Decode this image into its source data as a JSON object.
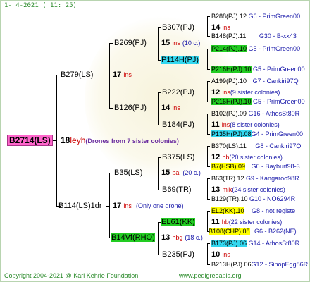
{
  "header": {
    "date_line": "1-  4-2021 ( 11: 25)"
  },
  "root": {
    "name": "B2714(LS)",
    "number": "18",
    "suffix": "leyh",
    "note": "(Drones from 7 sister colonies)"
  },
  "p1": {
    "name": "B279(LS)",
    "number": "17",
    "suffix": "ins"
  },
  "p2": {
    "name": "B114(LS)1dr",
    "number": "17",
    "suffix": "ins",
    "note": "(Only one drone)"
  },
  "g1": {
    "name": "B269(PJ)",
    "number": "15",
    "suffix": "ins",
    "note": "(10 c.)"
  },
  "g2": {
    "name": "B126(PJ)",
    "number": "14",
    "suffix": "ins"
  },
  "g3": {
    "name": "B35(LS)",
    "number": "15",
    "suffix": "bal",
    "note": "(20 c.)"
  },
  "g4": {
    "name": "B14Vf(RHO)",
    "number": "13",
    "suffix": "hbg",
    "note": "(18 c.)"
  },
  "gg": [
    {
      "name": "B307(PJ)",
      "number": "14",
      "suffix": "ins"
    },
    {
      "name": "P114H(PJ)"
    },
    {
      "name": "B222(PJ)",
      "number": "12",
      "suffix": "ins",
      "note": "(9 sister colonies)"
    },
    {
      "name": "B184(PJ)",
      "number": "11",
      "suffix": "ins",
      "note": "(8 sister colonies)"
    },
    {
      "name": "B375(LS)",
      "number": "12",
      "suffix": "hb",
      "note": "(20 sister colonies)"
    },
    {
      "name": "B69(TR)",
      "number": "13",
      "suffix": "mlk",
      "note": "(24 sister colonies)"
    },
    {
      "name": "EL61(KK)",
      "number": "11",
      "suffix": "hb",
      "note": "(22 sister colonies)"
    },
    {
      "name": "B235(PJ)",
      "number": "10",
      "suffix": "ins"
    }
  ],
  "right": [
    {
      "name": "B288(PJ).12",
      "info": "G6 - PrimGreen00"
    },
    {
      "name": "B148(PJ).11",
      "info": "G30 - B-xx43"
    },
    {
      "name": "P214(PJ).10",
      "info": "G5 - PrimGreen00"
    },
    {
      "name": "P216H(PJ).10",
      "info": "G5 - PrimGreen00"
    },
    {
      "name": "A199(PJ).10",
      "info": "G7 - Cankiri97Q"
    },
    {
      "name": "P216H(PJ).10",
      "info": "G5 - PrimGreen00"
    },
    {
      "name": "B102(PJ).09",
      "info": "G16 - AthosSt80R"
    },
    {
      "name": "P135H(PJ).08",
      "info": "G4 - PrimGreen00"
    },
    {
      "name": "B370(LS).11",
      "info": "G8 - Cankiri97Q"
    },
    {
      "name": "B7(HSB).09",
      "info": "G6 - Bayburt98-3"
    },
    {
      "name": "B63(TR).12",
      "info": "G9 - Kangaroo98R"
    },
    {
      "name": "B129(TR).10",
      "info": "G10 - NO6294R"
    },
    {
      "name": "EL2(KK).10",
      "info": "G8 - not registe"
    },
    {
      "name": "B108(CHP).08",
      "info": "G6 - B262(NE)"
    },
    {
      "name": "B173(PJ).06",
      "info": "G14 - AthosSt80R"
    },
    {
      "name": "B213H(PJ).06",
      "info": "G12 - SinopEgg86R"
    }
  ],
  "footer": {
    "copyright": "Copyright 2004-2021 @ Karl Kehrle Foundation",
    "url": "www.pedigreeapis.org"
  }
}
